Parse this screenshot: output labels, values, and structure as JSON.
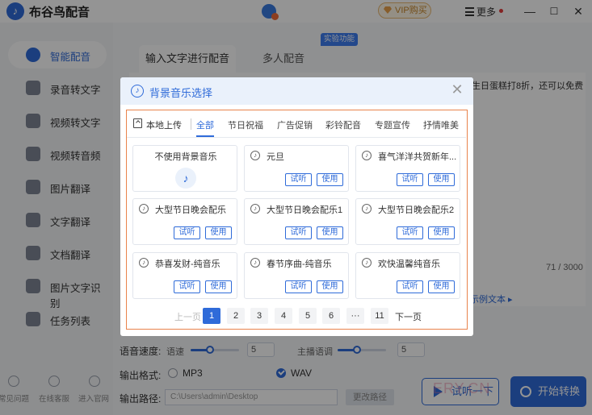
{
  "app": {
    "name": "布谷鸟配音",
    "vip_label": "VIP购买",
    "more_label": "更多",
    "win_min": "—",
    "win_max": "☐",
    "win_close": "✕"
  },
  "sidebar": {
    "items": [
      {
        "label": "智能配音",
        "icon": "mic-icon",
        "active": true
      },
      {
        "label": "录音转文字",
        "icon": "record-icon"
      },
      {
        "label": "视频转文字",
        "icon": "video-icon"
      },
      {
        "label": "视频转音频",
        "icon": "video-audio-icon"
      },
      {
        "label": "图片翻译",
        "icon": "image-translate-icon"
      },
      {
        "label": "文字翻译",
        "icon": "text-translate-icon"
      },
      {
        "label": "文档翻译",
        "icon": "doc-translate-icon"
      },
      {
        "label": "图片文字识别",
        "icon": "ocr-icon"
      },
      {
        "label": "任务列表",
        "icon": "task-list-icon"
      }
    ],
    "footer": [
      {
        "label": "常见问题",
        "icon": "help-icon"
      },
      {
        "label": "在线客服",
        "icon": "support-icon"
      },
      {
        "label": "进入官网",
        "icon": "website-icon"
      }
    ]
  },
  "main": {
    "tabs": [
      "输入文字进行配音",
      "多人配音"
    ],
    "tab_badge": "实验功能",
    "bg_text": "生日蛋糕打8折，还可以免费",
    "counter": "71 / 3000",
    "sample_link": "示例文本 ▸",
    "speed_label": "语音速度:",
    "speed_sub": "语速",
    "speed_value": "5",
    "volume_sub": "主播语调",
    "volume_value": "5",
    "format_label": "输出格式:",
    "format_options": [
      "MP3",
      "WAV"
    ],
    "format_selected": "WAV",
    "path_label": "输出路径:",
    "path_value": "C:\\Users\\admin\\Desktop",
    "change_dir": "更改路径",
    "trial_button": "试听一下",
    "start_button": "开始转换"
  },
  "modal": {
    "title": "背景音乐选择",
    "close": "✕",
    "local_upload": "本地上传",
    "categories": [
      "全部",
      "节日祝福",
      "广告促销",
      "彩铃配音",
      "专题宣传",
      "抒情唯美"
    ],
    "active_category": "全部",
    "no_music": "不使用背景音乐",
    "cards": [
      {
        "title": "元旦"
      },
      {
        "title": "喜气洋洋共贺新年..."
      },
      {
        "title": "大型节日晚会配乐"
      },
      {
        "title": "大型节日晚会配乐1"
      },
      {
        "title": "大型节日晚会配乐2"
      },
      {
        "title": "恭喜发财-纯音乐"
      },
      {
        "title": "春节序曲-纯音乐"
      },
      {
        "title": "欢快温馨纯音乐"
      }
    ],
    "preview_label": "试听",
    "use_label": "使用",
    "pagination": {
      "prev": "上一页",
      "pages": [
        "1",
        "2",
        "3",
        "4",
        "5",
        "6",
        "···",
        "11"
      ],
      "current": "1",
      "next": "下一页"
    }
  },
  "watermark": "ERY.CN"
}
